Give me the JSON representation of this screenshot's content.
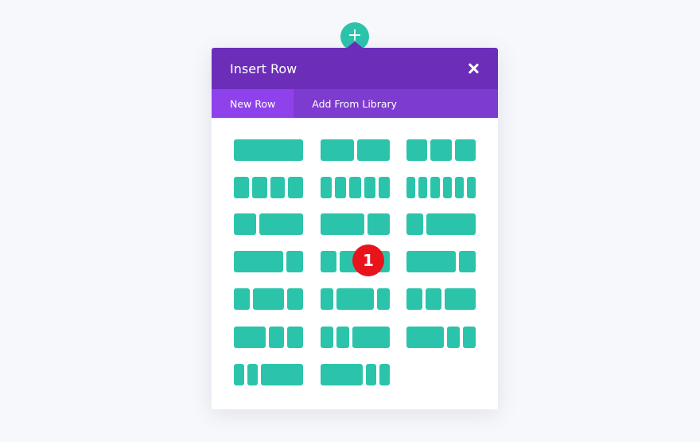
{
  "add_button": {
    "glyph": "+"
  },
  "modal": {
    "title": "Insert Row",
    "tabs": [
      {
        "label": "New Row",
        "active": true
      },
      {
        "label": "Add From Library",
        "active": false
      }
    ]
  },
  "layouts": [
    [
      1
    ],
    [
      1,
      1
    ],
    [
      1,
      1,
      1
    ],
    [
      1,
      1,
      1,
      1
    ],
    [
      1,
      1,
      1,
      1,
      1
    ],
    [
      1,
      1,
      1,
      1,
      1,
      1
    ],
    [
      1,
      2
    ],
    [
      2,
      1
    ],
    [
      1,
      3
    ],
    [
      3,
      1
    ],
    [
      1,
      2,
      1
    ],
    [
      3,
      1
    ],
    [
      1,
      2,
      1
    ],
    [
      1,
      3,
      1
    ],
    [
      1,
      1,
      2
    ],
    [
      2,
      1,
      1
    ],
    [
      1,
      1,
      3
    ],
    [
      3,
      1,
      1
    ],
    [
      1,
      1,
      4
    ],
    [
      4,
      1,
      1
    ]
  ],
  "step_badge": "1",
  "colors": {
    "header": "#6c2eb9",
    "tabs": "#7e3bd0",
    "active_tab": "#8f42ec",
    "accent": "#2bc4ab",
    "badge": "#e8131b"
  }
}
